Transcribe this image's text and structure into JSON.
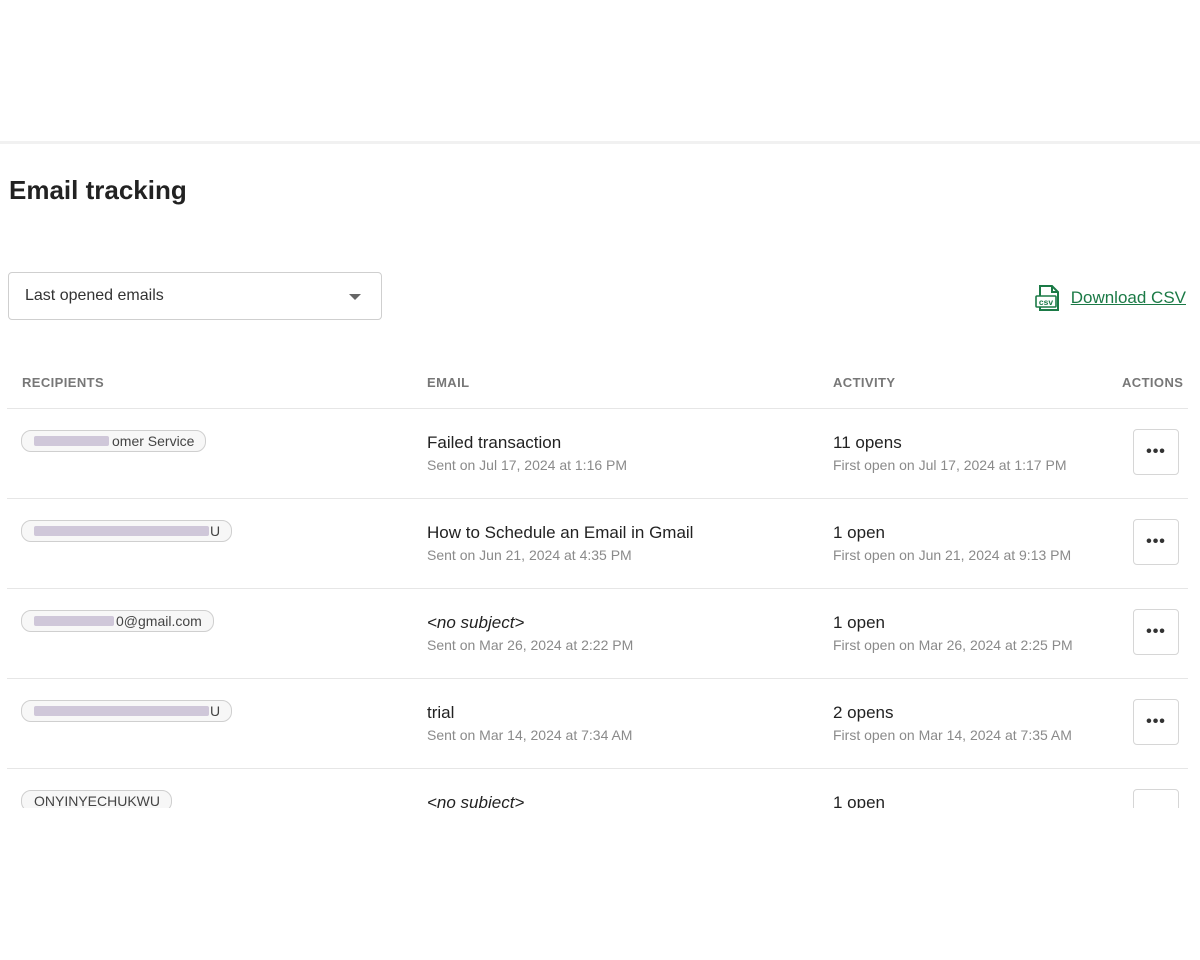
{
  "page": {
    "title": "Email tracking"
  },
  "filter": {
    "selected": "Last opened emails"
  },
  "download": {
    "label": "Download CSV",
    "icon_text": "csv",
    "icon": "csv-file-icon",
    "color": "#1b7a46"
  },
  "table": {
    "headers": {
      "recipients": "RECIPIENTS",
      "email": "EMAIL",
      "activity": "ACTIVITY",
      "actions": "ACTIONS"
    },
    "action_label": "•••",
    "rows": [
      {
        "recipient_visible": "omer Service",
        "subject": "Failed transaction",
        "sent": "Sent on Jul 17, 2024 at 1:16 PM",
        "opens": "11 opens",
        "first_open": "First open on Jul 17, 2024 at 1:17 PM"
      },
      {
        "recipient_visible": "U",
        "subject": "How to Schedule an Email in Gmail",
        "sent": "Sent on Jun 21, 2024 at 4:35 PM",
        "opens": "1 open",
        "first_open": "First open on Jun 21, 2024 at 9:13 PM"
      },
      {
        "recipient_visible": "0@gmail.com",
        "subject": "<no subject>",
        "sent": "Sent on Mar 26, 2024 at 2:22 PM",
        "opens": "1 open",
        "first_open": "First open on Mar 26, 2024 at 2:25 PM"
      },
      {
        "recipient_visible": "U",
        "subject": "trial",
        "sent": "Sent on Mar 14, 2024 at 7:34 AM",
        "opens": "2 opens",
        "first_open": "First open on Mar 14, 2024 at 7:35 AM"
      },
      {
        "recipient_visible": "ONYINYECHUKWU",
        "subject": "<no subject>",
        "sent": "",
        "opens": "1 open",
        "first_open": ""
      }
    ]
  }
}
